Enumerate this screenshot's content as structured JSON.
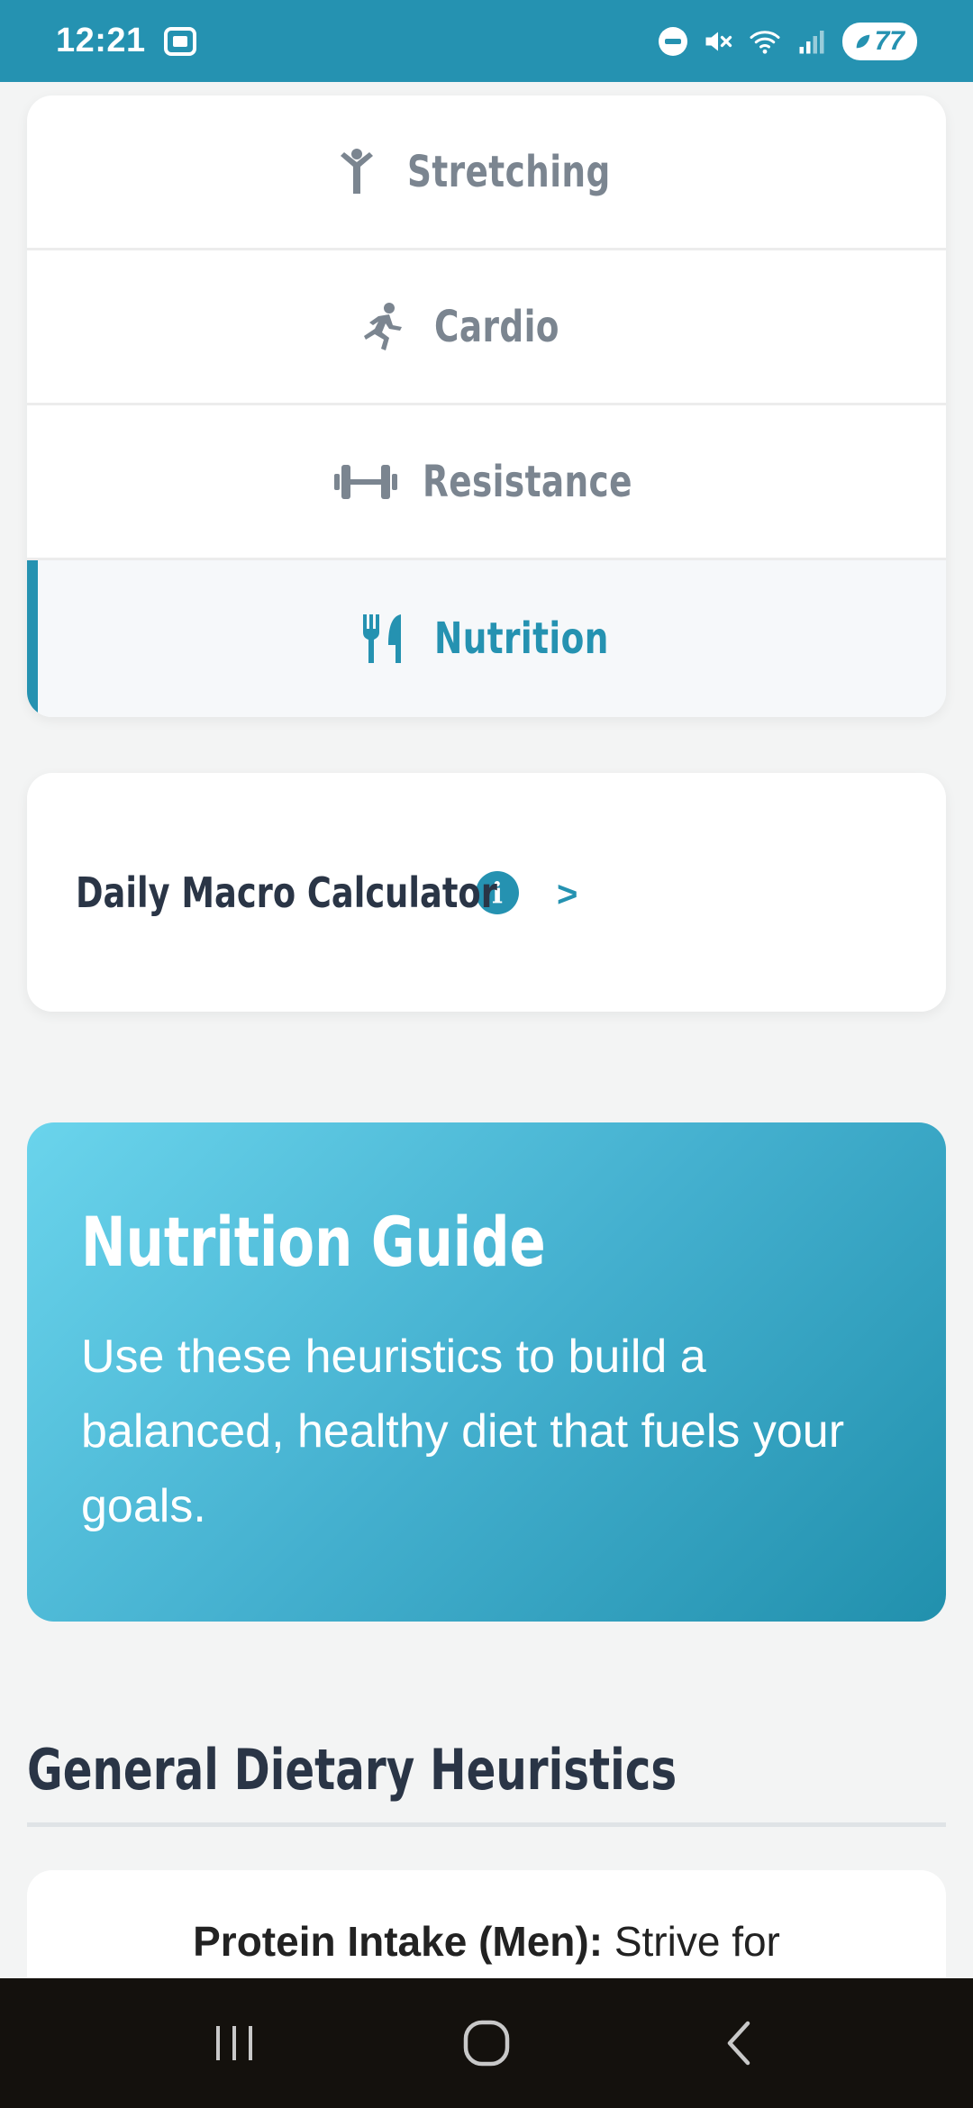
{
  "status_bar": {
    "time": "12:21",
    "battery": "77",
    "icons": [
      "screen-record-icon",
      "dnd-icon",
      "mute-icon",
      "wifi-icon",
      "signal-icon",
      "battery-icon"
    ]
  },
  "tabs": [
    {
      "label": "Stretching",
      "icon": "stretching-person-icon",
      "active": false
    },
    {
      "label": "Cardio",
      "icon": "running-person-icon",
      "active": false
    },
    {
      "label": "Resistance",
      "icon": "dumbbell-icon",
      "active": false
    },
    {
      "label": "Nutrition",
      "icon": "utensils-icon",
      "active": true
    }
  ],
  "macro_calculator": {
    "title": "Daily Macro Calculator",
    "info_glyph": "i",
    "chevron": ">"
  },
  "guide": {
    "title": "Nutrition Guide",
    "text": "Use these heuristics to build a balanced, healthy diet that fuels your goals."
  },
  "section": {
    "title": "General Dietary Heuristics"
  },
  "heuristics": [
    {
      "label": "Protein Intake (Men):",
      "text": " Strive for"
    }
  ],
  "colors": {
    "accent": "#2592b1",
    "tab_inactive": "#7b8590",
    "heading": "#2a3546",
    "background": "#f3f4f4"
  }
}
